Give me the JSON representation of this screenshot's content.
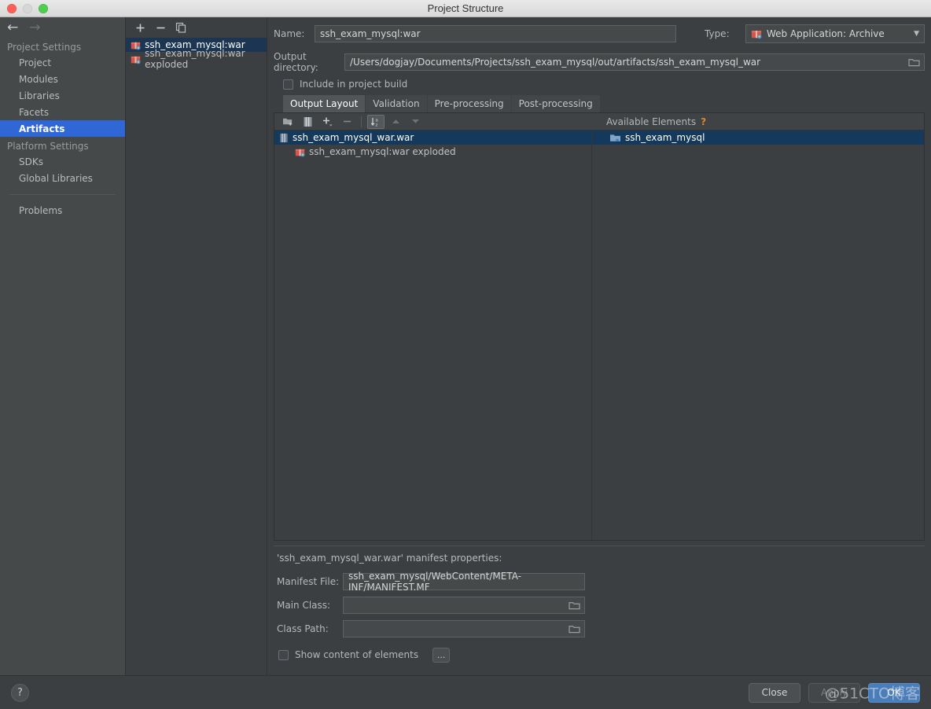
{
  "window": {
    "title": "Project Structure",
    "traffic_lights": [
      "close",
      "minimize",
      "zoom"
    ]
  },
  "sidebar": {
    "nav": {
      "back": "←",
      "forward": "→"
    },
    "groups": [
      {
        "label": "Project Settings",
        "items": [
          {
            "label": "Project",
            "selected": false
          },
          {
            "label": "Modules",
            "selected": false
          },
          {
            "label": "Libraries",
            "selected": false
          },
          {
            "label": "Facets",
            "selected": false
          },
          {
            "label": "Artifacts",
            "selected": true
          }
        ]
      },
      {
        "label": "Platform Settings",
        "items": [
          {
            "label": "SDKs",
            "selected": false
          },
          {
            "label": "Global Libraries",
            "selected": false
          }
        ]
      }
    ],
    "problems": "Problems"
  },
  "artifacts_panel": {
    "toolbar": [
      {
        "name": "add-artifact-button",
        "glyph": "+"
      },
      {
        "name": "remove-artifact-button",
        "glyph": "−"
      },
      {
        "name": "copy-artifact-button",
        "glyph": "copy-icon"
      }
    ],
    "items": [
      {
        "label": "ssh_exam_mysql:war",
        "selected": true
      },
      {
        "label": "ssh_exam_mysql:war exploded",
        "selected": false
      }
    ]
  },
  "detail": {
    "name_label": "Name:",
    "name_value": "ssh_exam_mysql:war",
    "type_label": "Type:",
    "type_value": "Web Application: Archive",
    "output_dir_label": "Output directory:",
    "output_dir_value": "/Users/dogjay/Documents/Projects/ssh_exam_mysql/out/artifacts/ssh_exam_mysql_war",
    "include_in_build_label": "Include in project build",
    "include_in_build_checked": false,
    "tabs": [
      {
        "label": "Output Layout",
        "active": true
      },
      {
        "label": "Validation",
        "active": false
      },
      {
        "label": "Pre-processing",
        "active": false
      },
      {
        "label": "Post-processing",
        "active": false
      }
    ]
  },
  "output_layout": {
    "toolbar": [
      {
        "name": "create-directory-button",
        "glyph": "folder-add-icon"
      },
      {
        "name": "create-archive-button",
        "glyph": "archive-icon"
      },
      {
        "name": "add-copy-of-button",
        "glyph": "+"
      },
      {
        "name": "remove-element-button",
        "glyph": "−"
      },
      {
        "name": "sort-button",
        "glyph": "sort-az-icon",
        "pressed": true
      },
      {
        "name": "move-up-button",
        "glyph": "▲",
        "disabled": true
      },
      {
        "name": "move-down-button",
        "glyph": "▼",
        "disabled": true
      }
    ],
    "available_elements_label": "Available Elements",
    "help_glyph": "?",
    "tree": [
      {
        "label": "ssh_exam_mysql_war.war",
        "icon": "archive-icon",
        "selected": true,
        "indent": 0
      },
      {
        "label": "ssh_exam_mysql:war exploded",
        "icon": "artifact-icon",
        "selected": false,
        "indent": 1
      }
    ],
    "available": [
      {
        "label": "ssh_exam_mysql",
        "icon": "module-folder-icon",
        "selected": true
      }
    ]
  },
  "manifest": {
    "title": "'ssh_exam_mysql_war.war' manifest properties:",
    "fields": [
      {
        "label": "Manifest File:",
        "value": "ssh_exam_mysql/WebContent/META-INF/MANIFEST.MF",
        "browse": false
      },
      {
        "label": "Main Class:",
        "value": "",
        "browse": true
      },
      {
        "label": "Class Path:",
        "value": "",
        "browse": true
      }
    ],
    "show_content_label": "Show content of elements",
    "show_content_checked": false,
    "dots_label": "..."
  },
  "footer": {
    "help": "?",
    "close": "Close",
    "apply": "Apply",
    "ok": "OK",
    "watermark": "@51CTO博客"
  }
}
